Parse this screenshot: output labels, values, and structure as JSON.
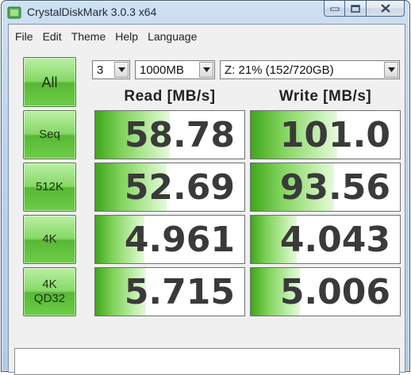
{
  "window": {
    "title": "CrystalDiskMark 3.0.3 x64"
  },
  "menu": [
    "File",
    "Edit",
    "Theme",
    "Help",
    "Language"
  ],
  "controls": {
    "all_label": "All",
    "count_value": "3",
    "size_value": "1000MB",
    "drive_value": "Z: 21% (152/720GB)"
  },
  "headers": {
    "read": "Read [MB/s]",
    "write": "Write [MB/s]"
  },
  "rows": [
    {
      "label": "Seq",
      "read": "58.78",
      "write": "101.0",
      "read_fill": 0.5,
      "write_fill": 0.58
    },
    {
      "label": "512K",
      "read": "52.69",
      "write": "93.56",
      "read_fill": 0.48,
      "write_fill": 0.56
    },
    {
      "label": "4K",
      "read": "4.961",
      "write": "4.043",
      "read_fill": 0.33,
      "write_fill": 0.31
    },
    {
      "label": "4K\nQD32",
      "read": "5.715",
      "write": "5.006",
      "read_fill": 0.34,
      "write_fill": 0.33
    }
  ],
  "status_text": "",
  "colors": {
    "accent_green": "#6ccd47",
    "bar_green": "#3ea61b",
    "value_text": "#3a3a3a"
  }
}
